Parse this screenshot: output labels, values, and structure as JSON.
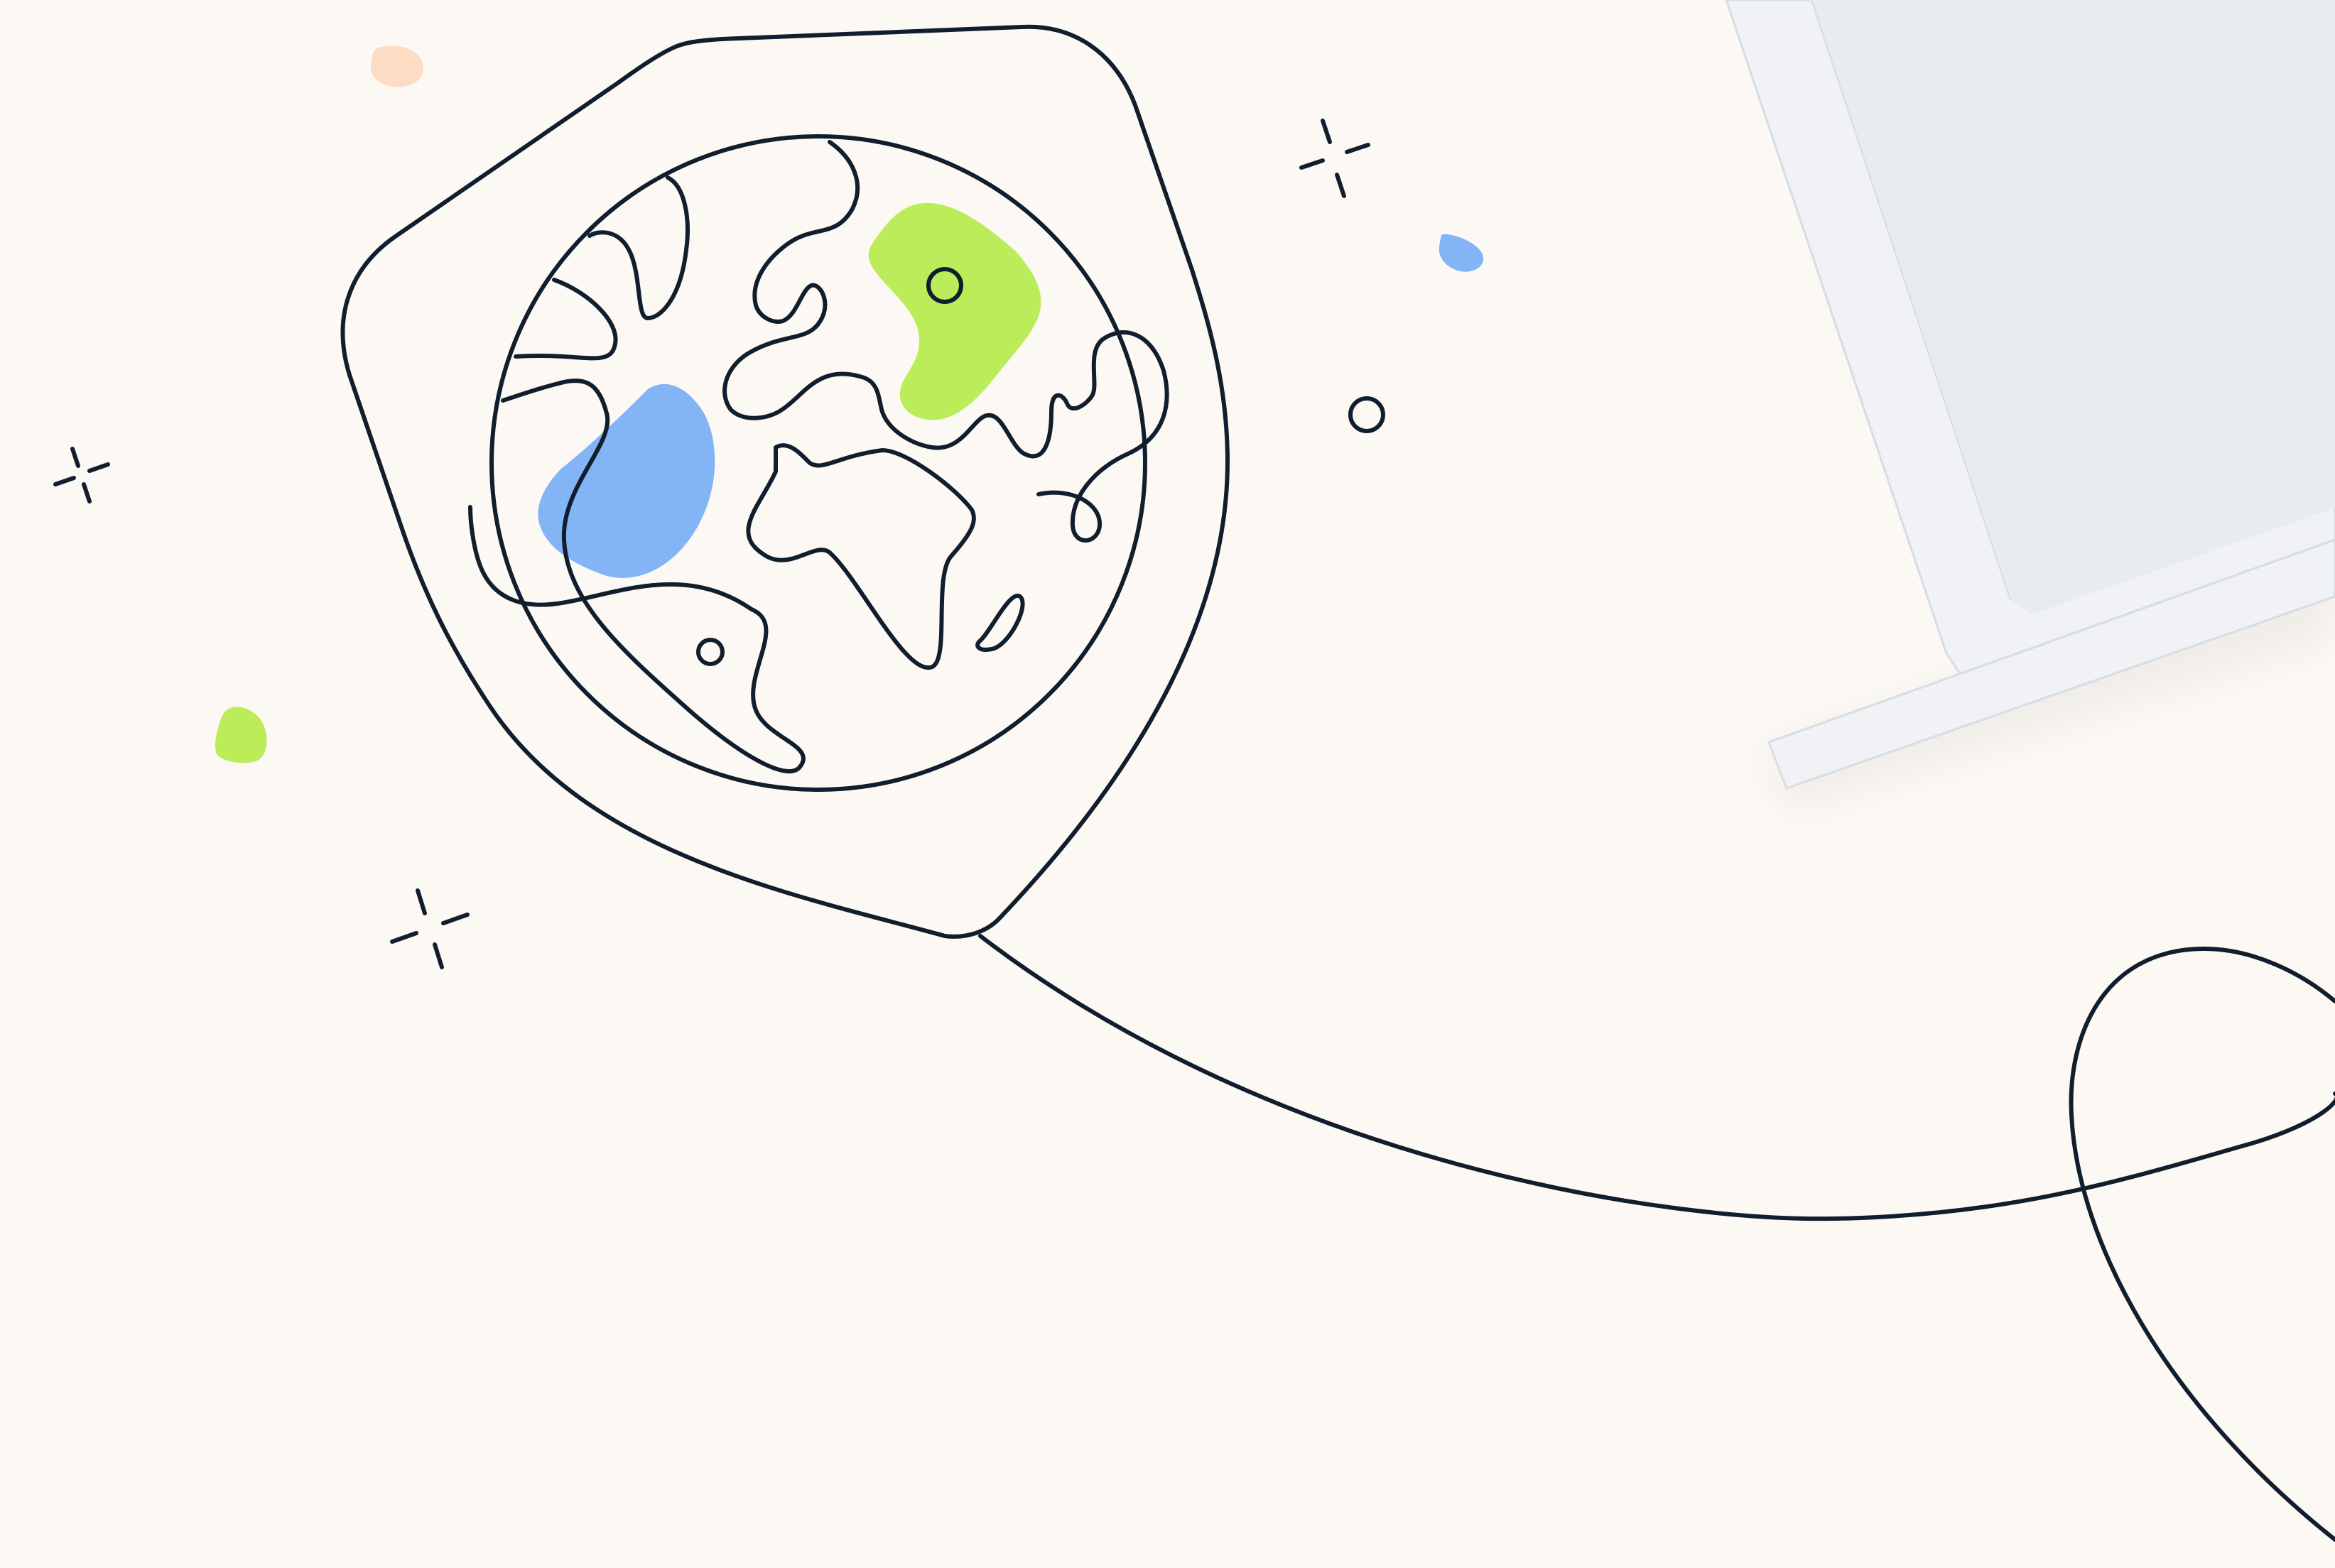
{
  "colors": {
    "background": "#fcf9f5",
    "ink": "#101e2d",
    "green": "#bbec5a",
    "blue": "#82b4f6",
    "peach": "#fcdcc2",
    "device_frame": "#f0f2f5",
    "device_screen": "#e8ebf0",
    "device_edge": "#d8dde3"
  },
  "icons": [
    "map-pin-icon",
    "globe-icon",
    "sparkle-icon",
    "location-dot-icon",
    "cable-line",
    "laptop-device"
  ]
}
